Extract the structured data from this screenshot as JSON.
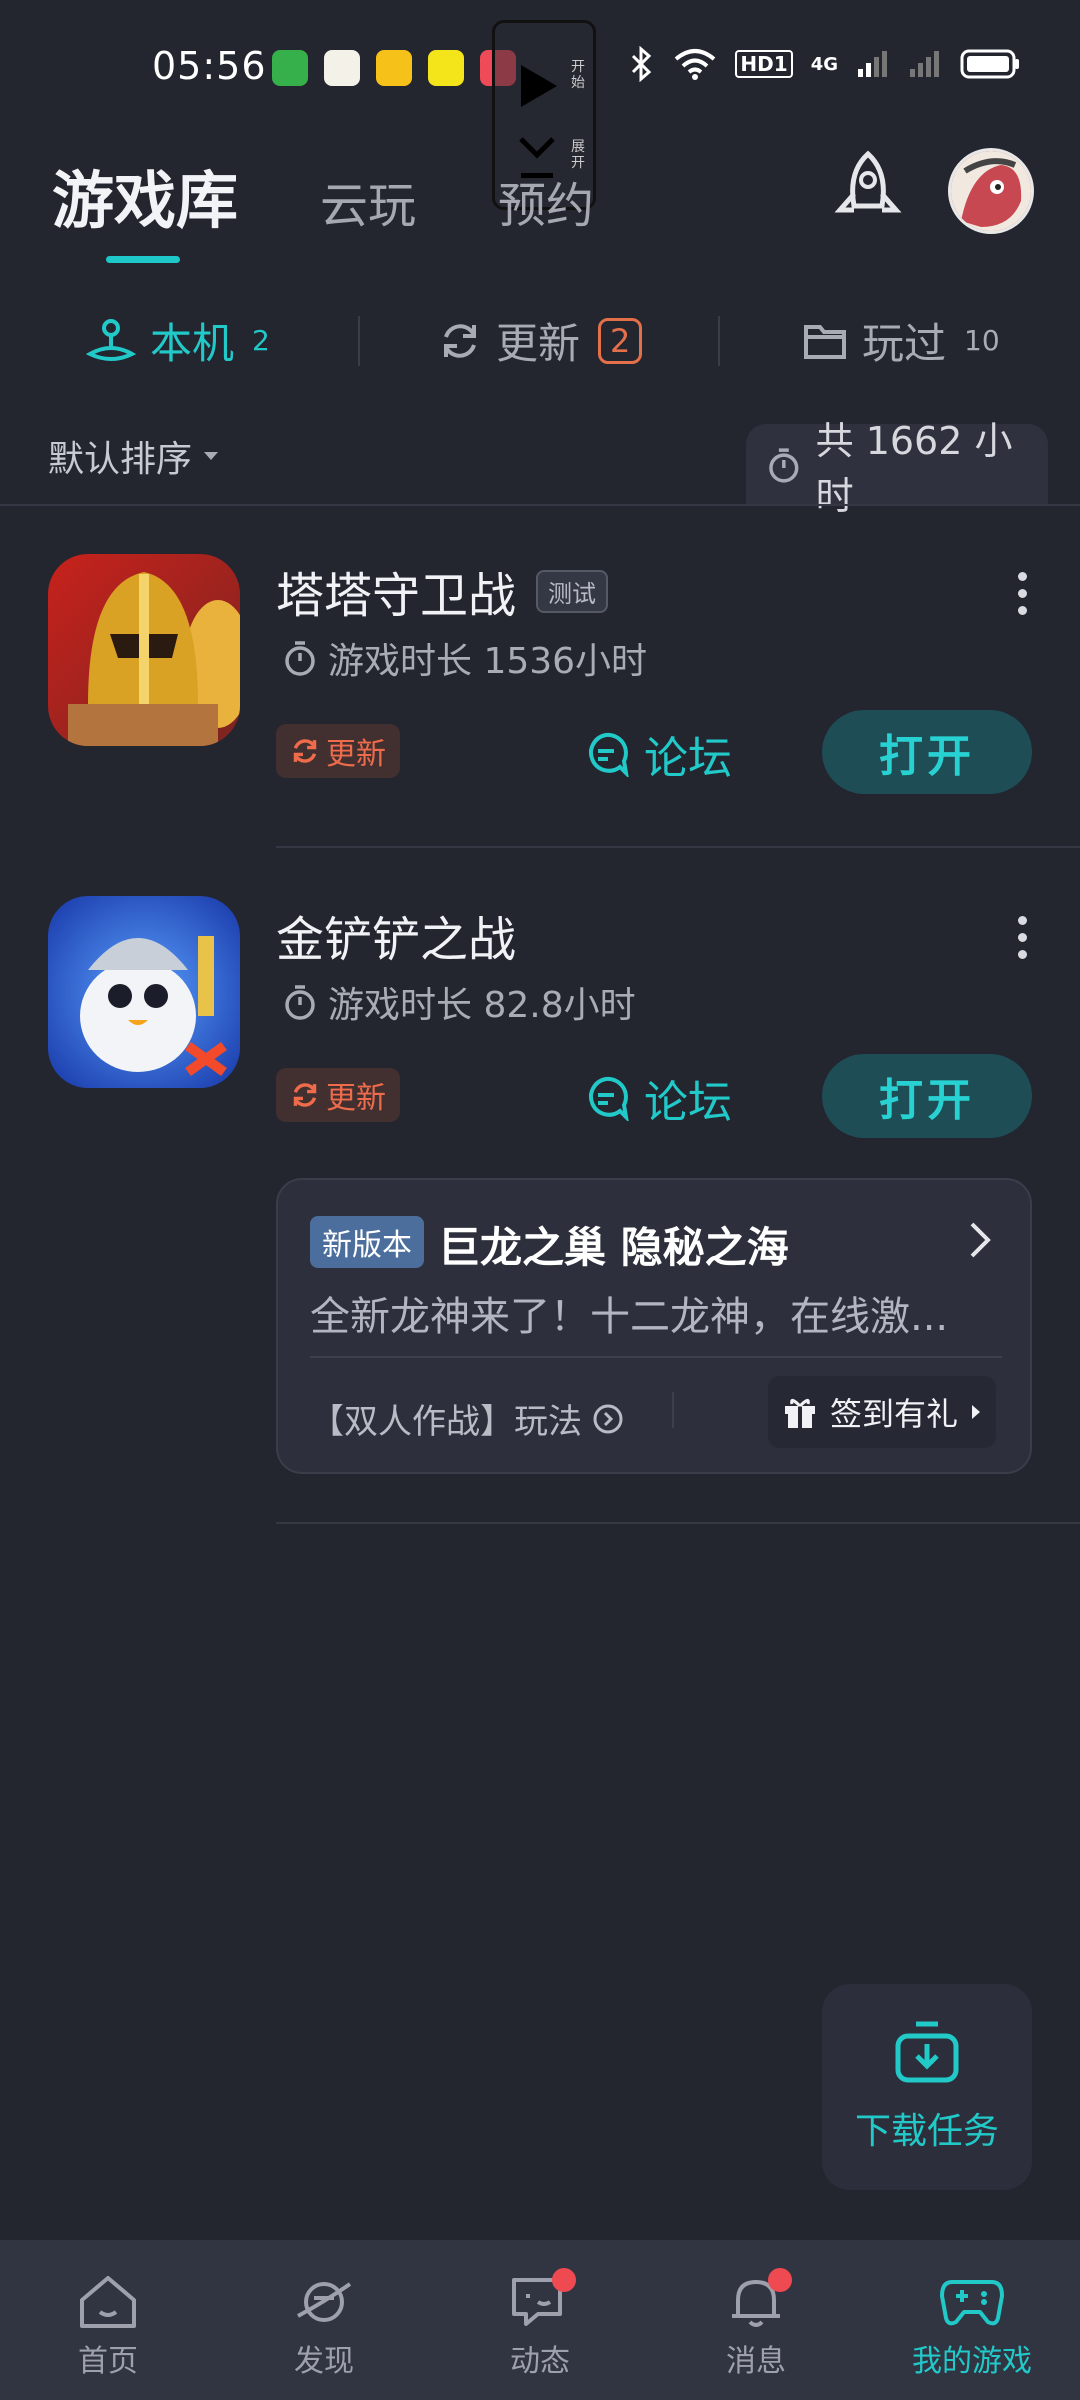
{
  "status_bar": {
    "time": "05:56",
    "player_labels": [
      "开始",
      "展开"
    ],
    "network": "HD1",
    "signal": "4G"
  },
  "top_tabs": [
    {
      "label": "游戏库",
      "active": true
    },
    {
      "label": "云玩",
      "active": false
    },
    {
      "label": "预约",
      "active": false
    }
  ],
  "filters": [
    {
      "label": "本机",
      "count": "2",
      "active": true
    },
    {
      "label": "更新",
      "count": "2",
      "active": false
    },
    {
      "label": "玩过",
      "count": "10",
      "active": false
    }
  ],
  "sort": {
    "label": "默认排序"
  },
  "total_time": "共 1662 小时",
  "games": [
    {
      "title": "塔塔守卫战",
      "tag": "测试",
      "playtime": "游戏时长 1536小时",
      "update_label": "更新",
      "forum_label": "论坛",
      "open_label": "打开"
    },
    {
      "title": "金铲铲之战",
      "tag": "",
      "playtime": "游戏时长 82.8小时",
      "update_label": "更新",
      "forum_label": "论坛",
      "open_label": "打开"
    }
  ],
  "news": {
    "tag": "新版本",
    "title": "巨龙之巢 隐秘之海",
    "desc": "全新龙神来了！十二龙神，在线激...",
    "bottom_left": "【双人作战】玩法",
    "sign_in": "签到有礼"
  },
  "download_task": "下载任务",
  "bottom_nav": [
    {
      "label": "首页",
      "icon": "home-icon",
      "active": false,
      "dot": false
    },
    {
      "label": "发现",
      "icon": "planet-icon",
      "active": false,
      "dot": false
    },
    {
      "label": "动态",
      "icon": "chat-icon",
      "active": false,
      "dot": true
    },
    {
      "label": "消息",
      "icon": "bell-icon",
      "active": false,
      "dot": true
    },
    {
      "label": "我的游戏",
      "icon": "gamepad-icon",
      "active": true,
      "dot": false
    }
  ],
  "colors": {
    "accent": "#22c9c9",
    "update": "#e4704a",
    "background": "#23252f"
  }
}
